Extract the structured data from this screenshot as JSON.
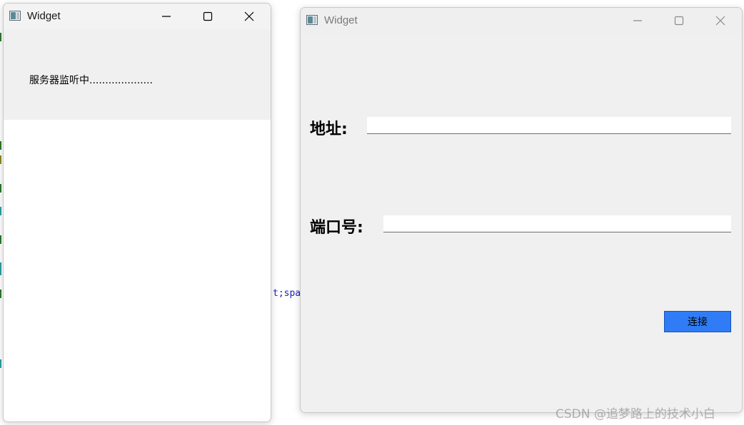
{
  "background_editor": {
    "fragment": "t;spa",
    "fragment_color_keyword": "#1c1cb8"
  },
  "server_window": {
    "title": "Widget",
    "status_text": "服务器监听中....................",
    "buttons": [
      "minimize",
      "maximize",
      "close"
    ]
  },
  "client_window": {
    "title": "Widget",
    "address_label": "地址:",
    "address_value": "",
    "port_label": "端口号:",
    "port_value": "",
    "connect_label": "连接",
    "buttons": [
      "minimize",
      "maximize",
      "close"
    ]
  },
  "watermark": "CSDN @追梦路上的技术小白",
  "colors": {
    "accent_button": "#2f7cf6",
    "window_background": "#f0f0f0",
    "title_inactive": "#7a7a7a"
  }
}
